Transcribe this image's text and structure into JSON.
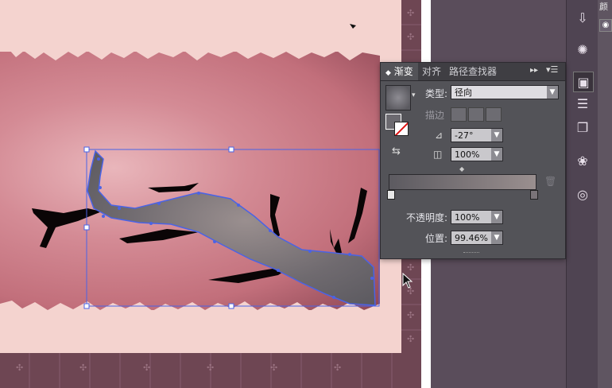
{
  "panel": {
    "tabs": [
      {
        "label": "渐变"
      },
      {
        "label": "对齐"
      },
      {
        "label": "路径查找器"
      }
    ],
    "type_label": "类型:",
    "type_value": "径向",
    "stroke_label": "描边",
    "angle_value": "-27°",
    "ratio_value": "100%",
    "opacity_label": "不透明度:",
    "opacity_value": "100%",
    "location_label": "位置:",
    "location_value": "99.46%"
  },
  "top_right_tab": "颜",
  "colors": {
    "panel_bg": "#535358",
    "tab_bar": "#3f3e43",
    "canvas_pink": "#c97d88",
    "border_brown": "#6e4653",
    "selection_blue": "#4a63e6",
    "gradient_dark": "#5c5a60",
    "gradient_light": "#9a8f8f"
  },
  "icons": {
    "fill_stroke": "fill-stroke-swatch-icon",
    "trash": "trash-icon",
    "cursor": "arrow-cursor-icon"
  }
}
